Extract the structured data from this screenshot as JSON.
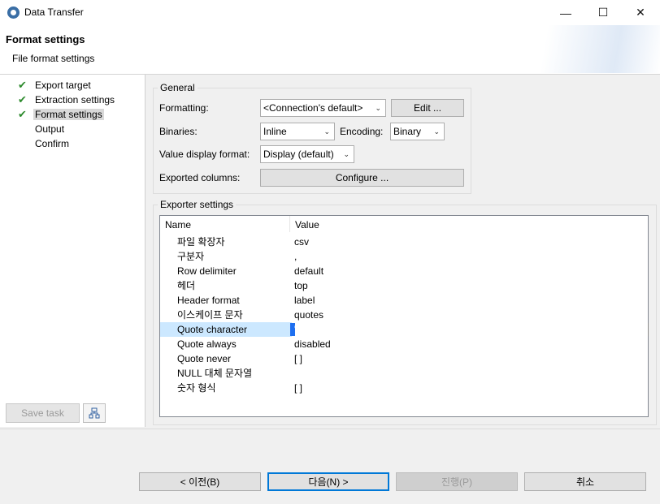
{
  "window": {
    "title": "Data Transfer",
    "minimize_icon": "minimize-icon",
    "maximize_icon": "maximize-icon",
    "close_icon": "close-icon"
  },
  "header": {
    "title": "Format settings",
    "subtitle": "File format settings"
  },
  "steps": [
    {
      "label": "Export target",
      "done": true
    },
    {
      "label": "Extraction settings",
      "done": true
    },
    {
      "label": "Format settings",
      "done": true,
      "selected": true
    },
    {
      "label": "Output",
      "done": false
    },
    {
      "label": "Confirm",
      "done": false
    }
  ],
  "left_footer": {
    "save_task": "Save task",
    "tree_icon": "hierarchy-icon"
  },
  "general": {
    "group_label": "General",
    "formatting_label": "Formatting:",
    "formatting_value": "<Connection's default>",
    "edit_button": "Edit ...",
    "binaries_label": "Binaries:",
    "binaries_value": "Inline",
    "encoding_label": "Encoding:",
    "encoding_value": "Binary",
    "value_display_label": "Value display format:",
    "value_display_value": "Display (default)",
    "exported_columns_label": "Exported columns:",
    "configure_button": "Configure ..."
  },
  "exporter": {
    "group_label": "Exporter settings",
    "columns": [
      "Name",
      "Value"
    ],
    "rows": [
      {
        "name": "파일 확장자",
        "value": "csv"
      },
      {
        "name": "구분자",
        "value": ","
      },
      {
        "name": "Row delimiter",
        "value": "default"
      },
      {
        "name": "헤더",
        "value": "top"
      },
      {
        "name": "Header format",
        "value": "label"
      },
      {
        "name": "이스케이프 문자",
        "value": "quotes"
      },
      {
        "name": "Quote character",
        "value": "\""
      },
      {
        "name": "Quote always",
        "value": "disabled"
      },
      {
        "name": "Quote never",
        "value": "[ ]"
      },
      {
        "name": "NULL 대체 문자열",
        "value": ""
      },
      {
        "name": "숫자 형식",
        "value": "[ ]"
      }
    ],
    "selected_row": 6
  },
  "footer": {
    "back": "< 이전(B)",
    "next": "다음(N) >",
    "run": "진행(P)",
    "cancel": "취소"
  },
  "colors": {
    "accent": "#0078d7",
    "selection": "#cce8ff",
    "check": "#2e8b2e"
  }
}
